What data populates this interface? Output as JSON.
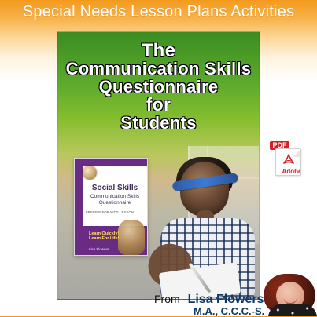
{
  "header": {
    "title": "Special Needs Lesson Plans Activities"
  },
  "poster": {
    "title_lines": [
      "The",
      "Communication Skills",
      "Questionnaire",
      "for",
      "Students"
    ]
  },
  "book_cover": {
    "title": "Social Skills",
    "subtitle_lines": [
      "Communication Skills",
      "Questionnaire"
    ],
    "small_text": "FREEBIE FOR KIDS LESSON",
    "learn_lines": [
      "Learn Quickly!",
      "Learn For Life!"
    ],
    "author": "Lisa Flowers"
  },
  "pdf": {
    "top": "PDF",
    "brand": "Adobe",
    "accent": "#d61f1f"
  },
  "footer": {
    "from_label": "From",
    "author_name": "Lisa Flowers",
    "credentials": "M.A., C.C.C.-S.L.P."
  },
  "icons": {
    "pdf": "pdf-icon",
    "adobe": "adobe-icon",
    "author_avatar": "author-avatar"
  },
  "colors": {
    "header_gradient_top": "#f39a1e",
    "footer_accent": "#0b3a6a",
    "book_purple": "#6a2b85"
  }
}
